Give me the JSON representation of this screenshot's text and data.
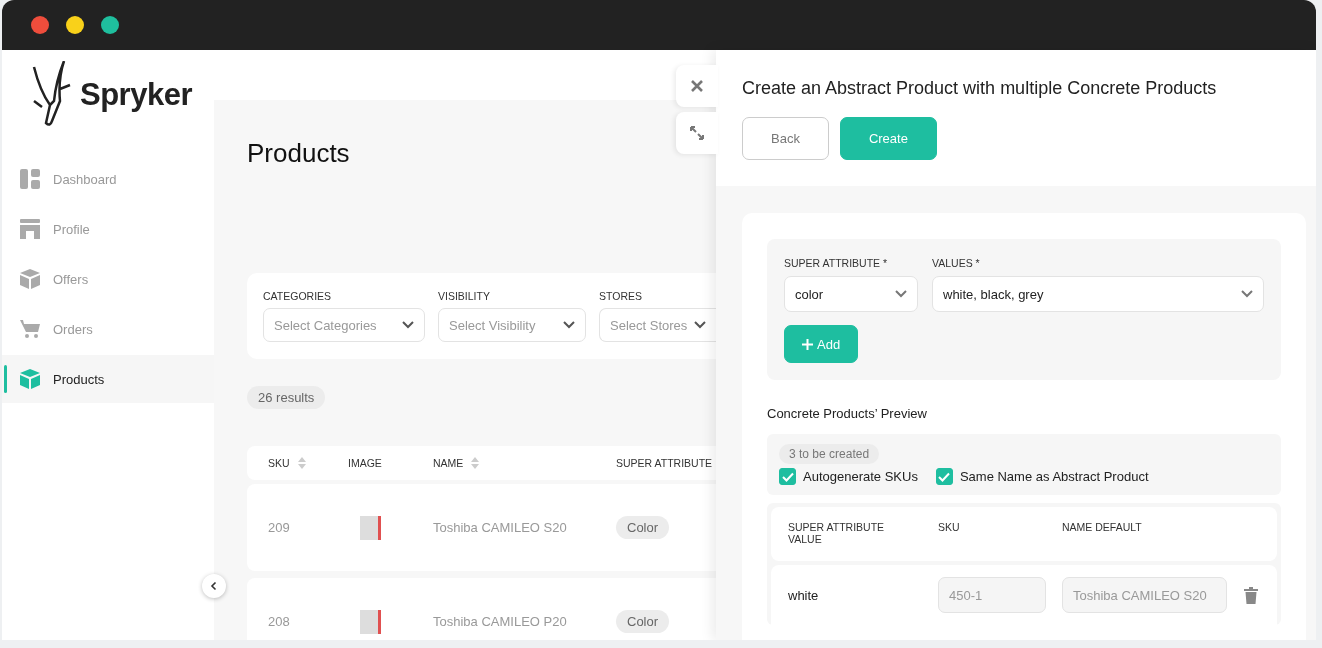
{
  "brand": {
    "name": "Spryker"
  },
  "sidebar": {
    "items": [
      {
        "label": "Dashboard",
        "selected": false
      },
      {
        "label": "Profile",
        "selected": false
      },
      {
        "label": "Offers",
        "selected": false
      },
      {
        "label": "Orders",
        "selected": false
      },
      {
        "label": "Products",
        "selected": true
      }
    ]
  },
  "page": {
    "title": "Products",
    "filters": [
      {
        "label": "CATEGORIES",
        "placeholder": "Select Categories"
      },
      {
        "label": "VISIBILITY",
        "placeholder": "Select Visibility"
      },
      {
        "label": "STORES",
        "placeholder": "Select Stores"
      }
    ],
    "results": "26 results",
    "table": {
      "columns": [
        {
          "label": "SKU",
          "sortable": true
        },
        {
          "label": "IMAGE",
          "sortable": false
        },
        {
          "label": "NAME",
          "sortable": true
        },
        {
          "label": "SUPER ATTRIBUTE"
        }
      ],
      "rows": [
        {
          "sku": "209",
          "name": "Toshiba CAMILEO S20",
          "attribute": "Color"
        },
        {
          "sku": "208",
          "name": "Toshiba CAMILEO P20",
          "attribute": "Color"
        }
      ]
    }
  },
  "panel": {
    "title": "Create an Abstract Product with multiple Concrete Products",
    "buttons": [
      {
        "label": "Back",
        "kind": "secondary"
      },
      {
        "label": "Create",
        "kind": "primary"
      }
    ],
    "attribute_field": {
      "label": "SUPER ATTRIBUTE *",
      "value": "color"
    },
    "values_field": {
      "label": "VALUES *",
      "value": "white, black, grey"
    },
    "add_button": "Add",
    "preview_title": "Concrete Products’ Preview",
    "count": "3 to be created",
    "options": [
      {
        "label": "Autogenerate SKUs",
        "checked": true
      },
      {
        "label": "Same Name as Abstract Product",
        "checked": true
      }
    ],
    "columns": [
      "SUPER ATTRIBUTE VALUE",
      "SKU",
      "NAME DEFAULT"
    ],
    "rows": [
      {
        "value": "white",
        "sku": {
          "value": "450-1",
          "disabled": true
        },
        "name": {
          "value": "Toshiba CAMILEO S20",
          "disabled": true
        }
      }
    ]
  }
}
